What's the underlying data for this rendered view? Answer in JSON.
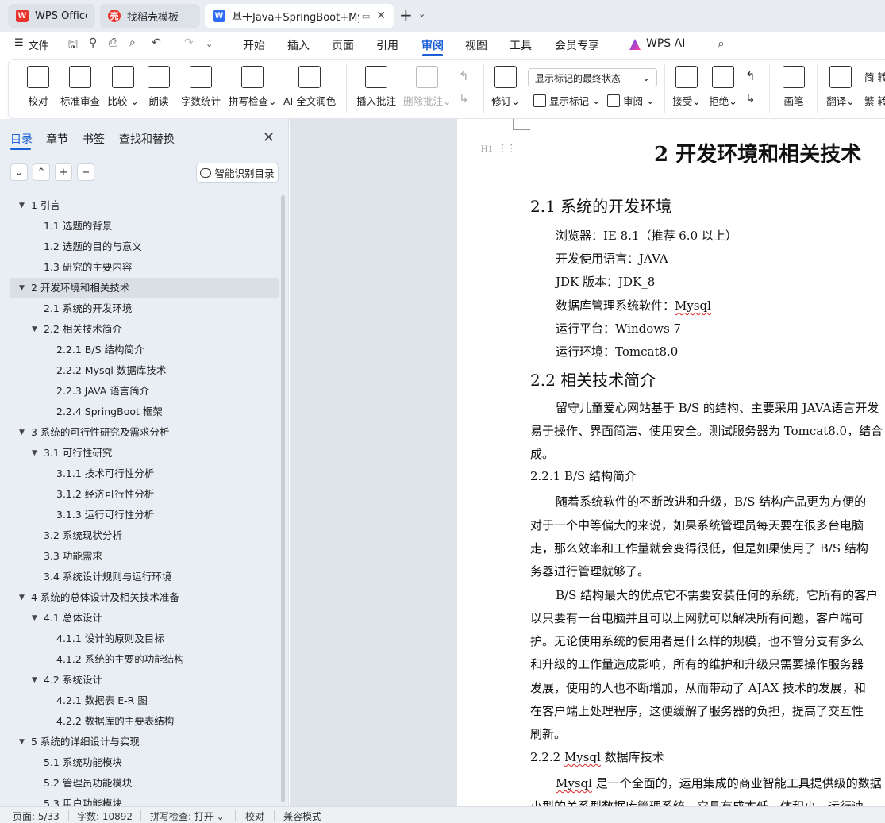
{
  "tabs": [
    {
      "label": "WPS Office",
      "icon": "wps-logo-icon"
    },
    {
      "label": "找稻壳模板",
      "icon": "daoke-logo-icon"
    },
    {
      "label": "基于Java+SpringBoot+MyS",
      "icon": "wps-writer-icon"
    }
  ],
  "menubar": {
    "file": "文件",
    "items": [
      "开始",
      "插入",
      "页面",
      "引用",
      "审阅",
      "视图",
      "工具",
      "会员专享",
      "WPS AI"
    ],
    "active": "审阅"
  },
  "ribbon": {
    "proofread": "校对",
    "standard_review": "标准审查",
    "compare": "比较",
    "read_aloud": "朗读",
    "word_count": "字数统计",
    "spell_check": "拼写检查",
    "ai_polish": "AI 全文润色",
    "insert_comment": "插入批注",
    "delete_comment": "删除批注",
    "track_changes": "修订",
    "markup_select": "显示标记的最终状态",
    "show_markup": "显示标记",
    "review": "审阅",
    "accept": "接受",
    "reject": "拒绝",
    "ink": "画笔",
    "translate": "翻译",
    "simp_label": "简",
    "trad_label": "繁",
    "trad_suffix": "转"
  },
  "nav": {
    "tabs": [
      "目录",
      "章节",
      "书签",
      "查找和替换"
    ],
    "active_tab": "目录",
    "ai_toc": "智能识别目录",
    "toc": [
      {
        "text": "1 引言",
        "level": 1,
        "expanded": true
      },
      {
        "text": "1.1 选题的背景",
        "level": 2
      },
      {
        "text": "1.2 选题的目的与意义",
        "level": 2
      },
      {
        "text": "1.3 研究的主要内容",
        "level": 2
      },
      {
        "text": "2  开发环境和相关技术",
        "level": 1,
        "expanded": true,
        "selected": true
      },
      {
        "text": "2.1 系统的开发环境",
        "level": 2
      },
      {
        "text": "2.2 相关技术简介",
        "level": 2,
        "expanded": true
      },
      {
        "text": "2.2.1 B/S 结构简介",
        "level": 3
      },
      {
        "text": "2.2.2 Mysql 数据库技术",
        "level": 3
      },
      {
        "text": "2.2.3 JAVA 语言简介",
        "level": 3
      },
      {
        "text": "2.2.4 SpringBoot 框架",
        "level": 3
      },
      {
        "text": "3 系统的可行性研究及需求分析",
        "level": 1,
        "expanded": true
      },
      {
        "text": "3.1 可行性研究",
        "level": 2,
        "expanded": true
      },
      {
        "text": "3.1.1 技术可行性分析",
        "level": 3
      },
      {
        "text": "3.1.2 经济可行性分析",
        "level": 3
      },
      {
        "text": "3.1.3 运行可行性分析",
        "level": 3
      },
      {
        "text": "3.2  系统现状分析",
        "level": 2
      },
      {
        "text": "3.3 功能需求",
        "level": 2
      },
      {
        "text": "3.4 系统设计规则与运行环境",
        "level": 2
      },
      {
        "text": "4 系统的总体设计及相关技术准备",
        "level": 1,
        "expanded": true
      },
      {
        "text": "4.1 总体设计",
        "level": 2,
        "expanded": true
      },
      {
        "text": "4.1.1 设计的原则及目标",
        "level": 3
      },
      {
        "text": "4.1.2 系统的主要的功能结构",
        "level": 3
      },
      {
        "text": "4.2 系统设计",
        "level": 2,
        "expanded": true
      },
      {
        "text": "4.2.1 数据表 E-R 图",
        "level": 3
      },
      {
        "text": "4.2.2  数据库的主要表结构",
        "level": 3
      },
      {
        "text": "5 系统的详细设计与实现",
        "level": 1,
        "expanded": true
      },
      {
        "text": "5.1 系统功能模块",
        "level": 2
      },
      {
        "text": "5.2 管理员功能模块",
        "level": 2
      },
      {
        "text": "5.3 用户功能模块",
        "level": 2
      }
    ]
  },
  "document": {
    "heading_marker": "H1",
    "chapter_title": "2  开发环境和相关技术",
    "sec21": "2.1 系统的开发环境",
    "env": {
      "browser": "浏览器：IE 8.1（推荐 6.0 以上）",
      "lang": "开发使用语言：JAVA",
      "jdk": "JDK 版本：JDK_8",
      "db_prefix": "数据库管理系统软件：",
      "db_value": "Mysql",
      "platform": "运行平台：Windows 7",
      "runtime": "运行环境：Tomcat8.0"
    },
    "sec22": "2.2 相关技术简介",
    "p1": [
      "留守儿童爱心网站基于 B/S 的结构、主要采用 JAVA语言开发",
      "易于操作、界面简洁、使用安全。测试服务器为 Tomcat8.0，结合",
      "成。"
    ],
    "sec221": "2.2.1 B/S 结构简介",
    "p2": [
      "随着系统软件的不断改进和升级，B/S 结构产品更为方便的",
      "对于一个中等偏大的来说，如果系统管理员每天要在很多台电脑",
      "走，那么效率和工作量就会变得很低，但是如果使用了 B/S 结构",
      "务器进行管理就够了。"
    ],
    "p3": [
      "B/S 结构最大的优点它不需要安装任何的系统，它所有的客户",
      "以只要有一台电脑并且可以上网就可以解决所有问题，客户端可",
      "护。无论使用系统的使用者是什么样的规模，也不管分支有多么",
      "和升级的工作量造成影响，所有的维护和升级只需要操作服务器",
      "发展，使用的人也不断增加，从而带动了 AJAX 技术的发展，和",
      "在客户端上处理程序，这便缓解了服务器的负担，提高了交互性",
      "刷新。"
    ],
    "sec222_prefix": "2.2.2 ",
    "sec222_word": "Mysql",
    "sec222_suffix": " 数据库技术",
    "p4_word": "Mysql",
    "p4_rest": " 是一个全面的，运用集成的商业智能工具提供级的数据",
    "p4_line2": "小型的关系型数据库管理系统，它具有成本低、体积小、运行速"
  },
  "status": {
    "page": "页面: 5/33",
    "words": "字数: 10892",
    "spell": "拼写检查: 打开",
    "proof": "校对",
    "compat": "兼容模式"
  }
}
